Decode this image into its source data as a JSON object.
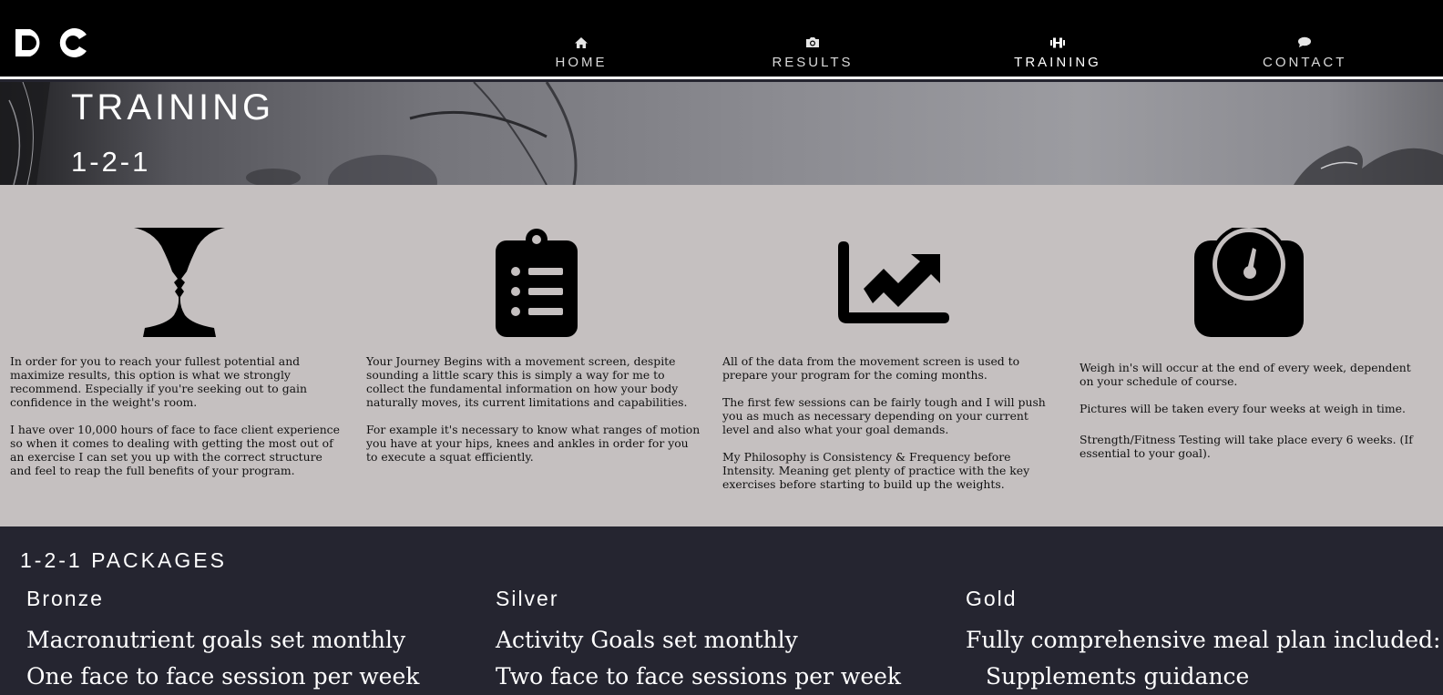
{
  "logo": {
    "text": "DC"
  },
  "nav": {
    "items": [
      {
        "label": "HOME",
        "icon": "home-icon",
        "active": false
      },
      {
        "label": "RESULTS",
        "icon": "camera-icon",
        "active": false
      },
      {
        "label": "TRAINING",
        "icon": "dumbbell-icon",
        "active": true
      },
      {
        "label": "CONTACT",
        "icon": "chat-bubble-icon",
        "active": false
      }
    ]
  },
  "hero": {
    "title": "TRAINING",
    "subtitle": "1-2-1"
  },
  "features": [
    {
      "icon": "face-vase-icon",
      "paragraphs": [
        "In order for you to reach your fullest potential and maximize results, this option is what we strongly recommend. Especially if you're seeking out to gain confidence in the weight's room.",
        "I have over 10,000 hours of face to face client experience so when it comes to dealing with getting the most out of an exercise I can set you up with the correct structure and feel to reap the full benefits of your program."
      ]
    },
    {
      "icon": "clipboard-list-icon",
      "paragraphs": [
        "Your Journey Begins with a movement screen, despite sounding a little scary this is simply a way for me to collect the fundamental information on how your body naturally moves, its current limitations and capabilities.",
        "For example it's necessary to know what ranges of motion you have at your hips, knees and ankles in order for you to execute a squat efficiently."
      ]
    },
    {
      "icon": "chart-line-up-icon",
      "paragraphs": [
        "All of the data from the movement screen is used to prepare your program for the coming months.",
        "The first few sessions can be fairly tough and I will push you as much as necessary depending on your current level and also what your goal demands.",
        "My Philosophy is Consistency & Frequency before Intensity. Meaning get plenty of practice with the key exercises before starting to build up the weights."
      ]
    },
    {
      "icon": "weighing-scale-icon",
      "paragraphs": [
        "Weigh in's will occur at the end of every week, dependent on your schedule of course.",
        "Pictures will be taken every four weeks at weigh in time.",
        "Strength/Fitness Testing will take place every 6 weeks. (If essential to your goal)."
      ]
    }
  ],
  "packages": {
    "title": "1-2-1 PACKAGES",
    "tiers": [
      {
        "name": "Bronze",
        "lines": [
          "Macronutrient goals set monthly",
          "One face to face session per week"
        ]
      },
      {
        "name": "Silver",
        "lines": [
          "Activity Goals set monthly",
          "Two face to face sessions per week"
        ]
      },
      {
        "name": "Gold",
        "lines": [
          "Fully comprehensive meal plan included:",
          "Supplements guidance"
        ]
      }
    ]
  },
  "colors": {
    "nav_bg": "#000000",
    "features_bg": "#c5c0c0",
    "packages_bg": "#252530",
    "text_light": "#ffffff"
  }
}
